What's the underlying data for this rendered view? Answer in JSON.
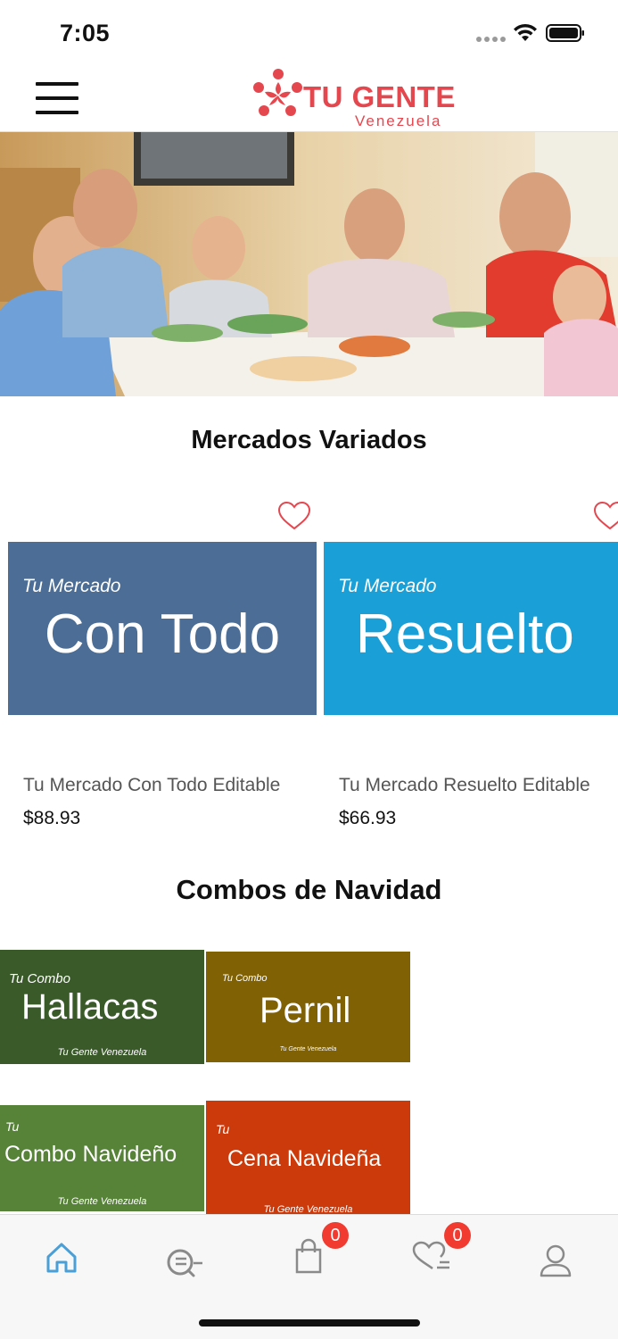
{
  "status_bar": {
    "time": "7:05"
  },
  "header": {
    "logo_name": "TU GENTE",
    "logo_sub": "Venezuela"
  },
  "sections": {
    "markets_title": "Mercados Variados",
    "combos_title": "Combos de Navidad"
  },
  "products": [
    {
      "banner_kicker": "Tu Mercado",
      "banner_main": "Con Todo",
      "banner_color": "#4b6d96",
      "name": "Tu Mercado Con Todo Editable",
      "price": "$88.93"
    },
    {
      "banner_kicker": "Tu Mercado",
      "banner_main": "Resuelto",
      "banner_color": "#1a9fd6",
      "name": "Tu Mercado Resuelto Editable",
      "price": "$66.93"
    }
  ],
  "combos": [
    {
      "kicker": "Tu Combo",
      "main": "Hallacas",
      "footer": "Tu Gente Venezuela",
      "color": "#3a5a2a"
    },
    {
      "kicker": "Tu Combo",
      "main": "Pernil",
      "footer": "Tu Gente Venezuela",
      "color": "#806205"
    },
    {
      "kicker": "Tu",
      "main": "Combo Navideño",
      "footer": "Tu Gente Venezuela",
      "color": "#568337"
    },
    {
      "kicker": "Tu",
      "main": "Cena Navideña",
      "footer": "Tu Gente Venezuela",
      "color": "#cc3a0c"
    }
  ],
  "tab_bar": {
    "cart_badge": "0",
    "wishlist_badge": "0",
    "active_color": "#4a9fd6",
    "inactive_color": "#8a8a8a"
  },
  "colors": {
    "brand": "#e5474f",
    "badge": "#f23b30"
  }
}
